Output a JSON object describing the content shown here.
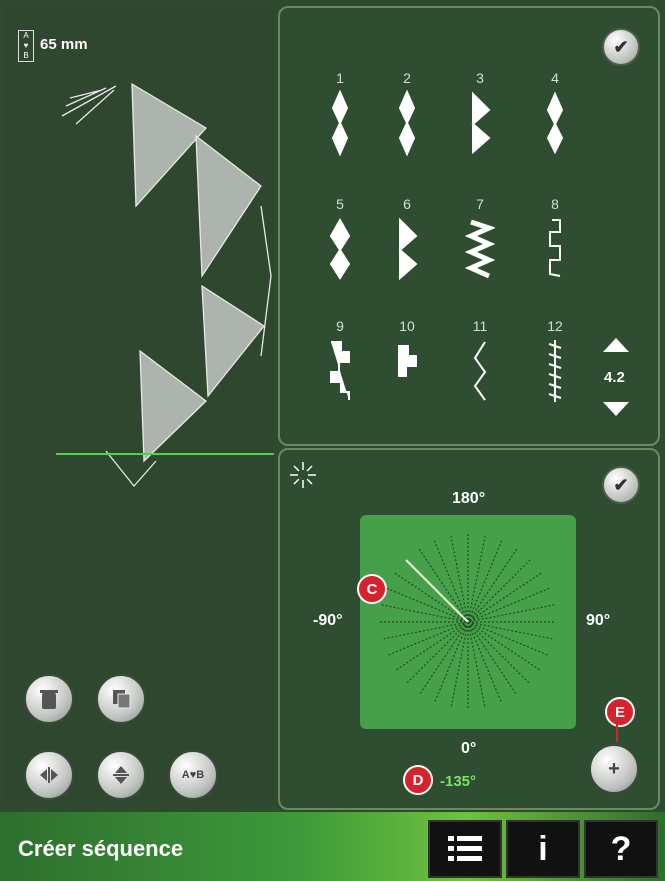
{
  "header": {
    "size_label": "65 mm",
    "size_icon": "A♥B"
  },
  "stitches": [
    {
      "num": "1"
    },
    {
      "num": "2"
    },
    {
      "num": "3"
    },
    {
      "num": "4"
    },
    {
      "num": "5"
    },
    {
      "num": "6"
    },
    {
      "num": "7"
    },
    {
      "num": "8"
    },
    {
      "num": "9"
    },
    {
      "num": "10"
    },
    {
      "num": "11"
    },
    {
      "num": "12"
    }
  ],
  "scroll": {
    "value": "4.2"
  },
  "angle": {
    "top": "180°",
    "left": "-90°",
    "right": "90°",
    "bottom": "0°",
    "current": "-135°"
  },
  "markers": {
    "c": "C",
    "d": "D",
    "e": "E"
  },
  "buttons": {
    "plus": "+",
    "check": "✔",
    "abb": "A♥B"
  },
  "footer": {
    "title": "Créer séquence",
    "info": "i",
    "help": "?"
  },
  "colors": {
    "accent": "#46a049",
    "marker": "#d6222b",
    "current_angle": "#7ee06b"
  }
}
